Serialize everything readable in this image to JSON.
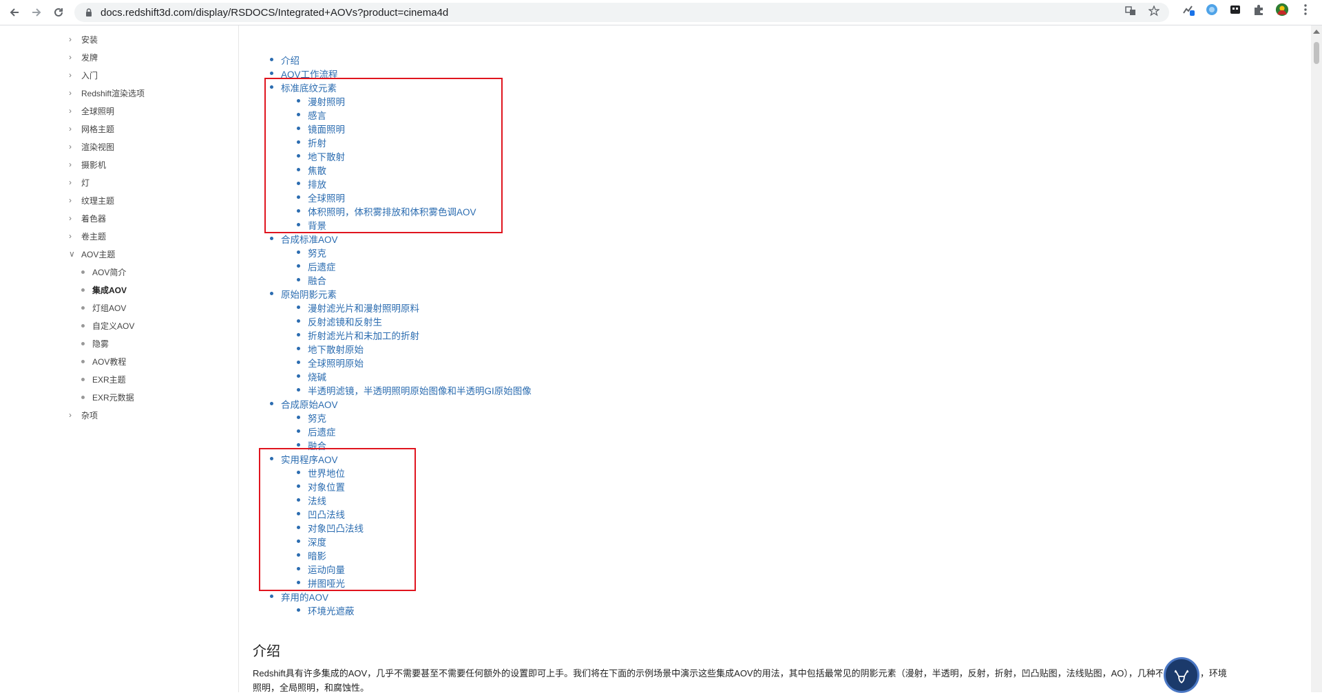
{
  "browser": {
    "url": "docs.redshift3d.com/display/RSDOCS/Integrated+AOVs?product=cinema4d",
    "back_icon": "arrow-left-icon",
    "forward_icon": "arrow-right-icon",
    "reload_icon": "reload-icon",
    "lock_icon": "lock-icon"
  },
  "sidebar": {
    "items": [
      "安装",
      "发牌",
      "入门",
      "Redshift渲染选项",
      "全球照明",
      "网格主题",
      "渲染视图",
      "摄影机",
      "灯",
      "纹理主题",
      "着色器",
      "卷主题",
      "AOV主题"
    ],
    "aov_sub": [
      "AOV简介",
      "集成AOV",
      "灯组AOV",
      "自定义AOV",
      "隐雾",
      "AOV教程",
      "EXR主题",
      "EXR元数据"
    ],
    "after": [
      "杂项"
    ],
    "active": "集成AOV"
  },
  "toc": {
    "l1": [
      "介绍",
      "AOV工作流程",
      "标准底纹元素",
      "合成标准AOV",
      "原始阴影元素",
      "合成原始AOV",
      "实用程序AOV",
      "弃用的AOV"
    ],
    "standard": [
      "漫射照明",
      "感言",
      "镜面照明",
      "折射",
      "地下散射",
      "焦散",
      "排放",
      "全球照明",
      "体积照明，体积雾排放和体积雾色调AOV",
      "背景"
    ],
    "composite_std": [
      "努克",
      "后遗症",
      "融合"
    ],
    "raw": [
      "漫射滤光片和漫射照明原料",
      "反射滤镜和反射生",
      "折射滤光片和未加工的折射",
      "地下散射原始",
      "全球照明原始",
      "烧碱",
      "半透明滤镜，半透明照明原始图像和半透明GI原始图像"
    ],
    "composite_raw": [
      "努克",
      "后遗症",
      "融合"
    ],
    "utility": [
      "世界地位",
      "对象位置",
      "法线",
      "凹凸法线",
      "对象凹凸法线",
      "深度",
      "暗影",
      "运动向量",
      "拼图哑光"
    ],
    "deprecated": [
      "环境光遮蔽"
    ]
  },
  "section": {
    "title": "介绍",
    "para": "Redshift具有许多集成的AOV，几乎不需要甚至不需要任何额外的设置即可上手。我们将在下面的示例场景中演示这些集成AOV的用法，其中包括最常见的阴影元素（漫射，半透明，反射，折射，凹凸贴图，法线贴图，AO），几种不同的光源，环境照明，全局照明，和腐蚀性。"
  },
  "colors": {
    "link": "#2b6cb0",
    "highlight": "#e0141e"
  }
}
